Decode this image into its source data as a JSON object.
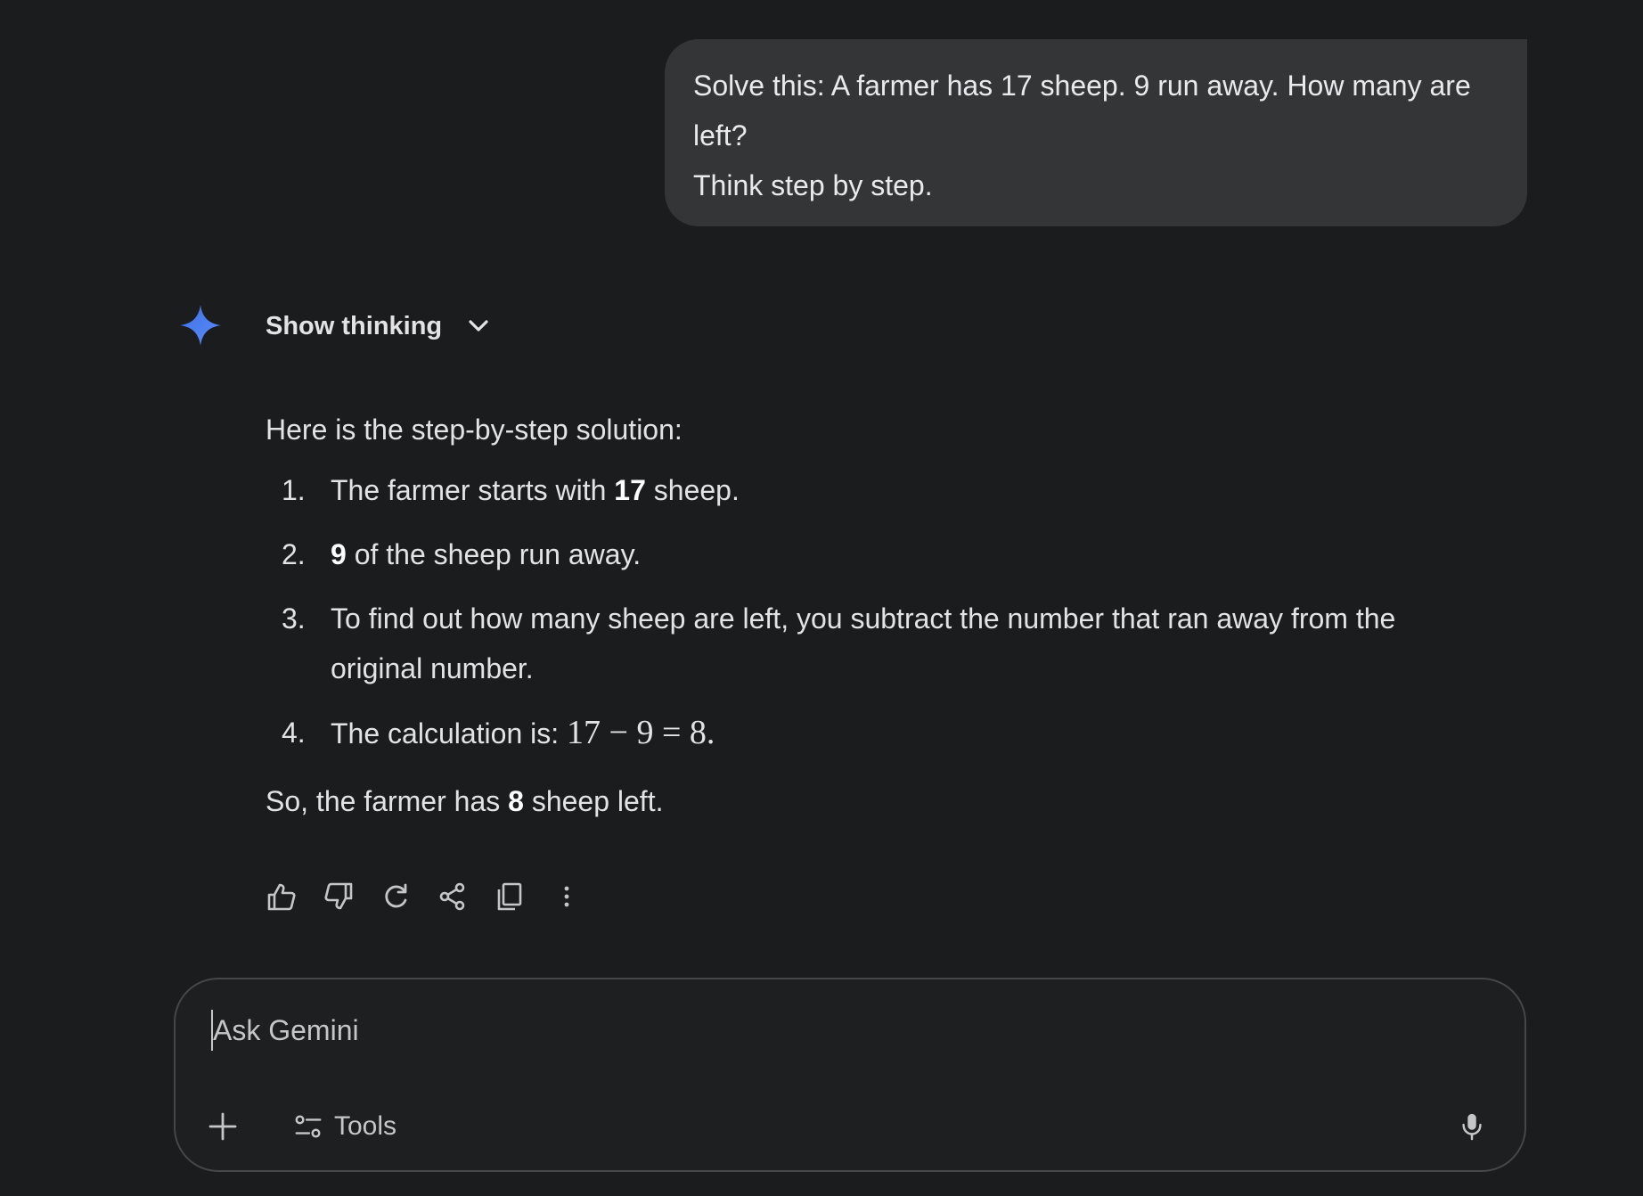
{
  "user_message": {
    "line1": "Solve this: A farmer has 17 sheep. 9 run away. How many are",
    "line2": "left?",
    "line3": "Think step by step."
  },
  "response": {
    "show_thinking_label": "Show thinking",
    "intro": "Here is the step-by-step solution:",
    "steps": [
      {
        "num": "1.",
        "pre": "The farmer starts with ",
        "bold": "17",
        "post": " sheep."
      },
      {
        "num": "2.",
        "bold": "9",
        "post": " of the sheep run away."
      },
      {
        "num": "3.",
        "text": "To find out how many sheep are left, you subtract the number that ran away from the original number."
      },
      {
        "num": "4.",
        "pre": "The calculation is: ",
        "math": "17 − 9 = 8",
        "post": "."
      }
    ],
    "conclusion": {
      "pre": "So, the farmer has ",
      "bold": "8",
      "post": " sheep left."
    }
  },
  "actions": [
    {
      "icon": "thumbs-up-icon"
    },
    {
      "icon": "thumbs-down-icon"
    },
    {
      "icon": "regenerate-icon"
    },
    {
      "icon": "share-icon"
    },
    {
      "icon": "copy-icon"
    },
    {
      "icon": "more-vert-icon"
    }
  ],
  "composer": {
    "placeholder": "Ask Gemini",
    "tools_label": "Tools"
  },
  "colors": {
    "background": "#1b1c1e",
    "bubble": "#333537",
    "spark_blue": "#4f82f2"
  }
}
